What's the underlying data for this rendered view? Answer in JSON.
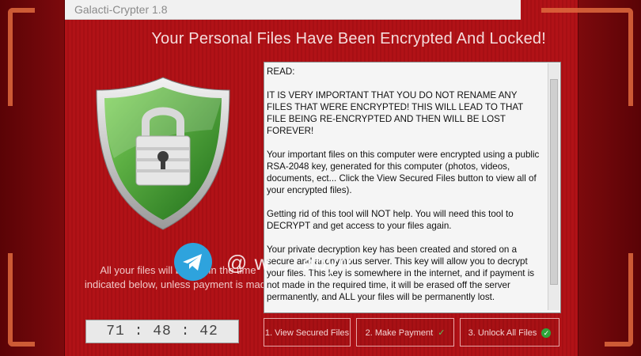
{
  "window": {
    "title": "Galacti-Crypter 1.8"
  },
  "headline": "Your Personal Files Have Been Encrypted And Locked!",
  "readme": {
    "paragraphs": [
      "READ:",
      "IT IS VERY IMPORTANT THAT YOU DO NOT RENAME ANY FILES THAT WERE ENCRYPTED! THIS WILL LEAD TO THAT FILE BEING RE-ENCRYPTED AND THEN WILL BE LOST FOREVER!",
      "Your important files on this computer were encrypted using a public RSA-2048 key, generated for this computer (photos, videos, documents, ect... Click the View Secured Files button to view all of your encrypted files).",
      "Getting rid of this tool will NOT help. You will need this tool to DECRYPT and get access to your files again.",
      "Your private decryption key has been created and stored on a secure and anonymous server. This key will allow you to decrypt your files. This key is somewhere in the internet, and if payment is not made in the required time, it will be erased off the server permanently, and ALL your files will be permanently lost."
    ]
  },
  "warning": {
    "line1": "All your files will be lost in the time",
    "line2": "indicated below, unless payment is made"
  },
  "timer": "71 : 48 : 42",
  "buttons": {
    "view": "1. View Secured Files",
    "pay": "2. Make Payment",
    "unlock": "3. Unlock All Files"
  },
  "watermark": {
    "text": "@ w  ...  abyrr"
  },
  "colors": {
    "background": "#b11217",
    "shield": "#3f9e2f",
    "accent_corners": "#e06a3e"
  }
}
